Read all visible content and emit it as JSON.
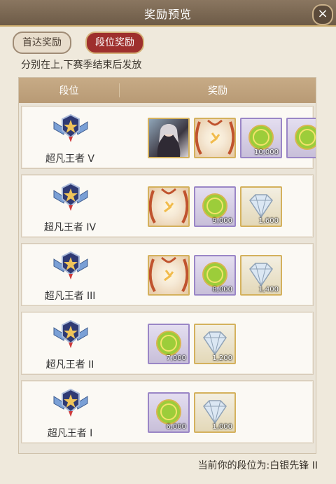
{
  "header": {
    "title": "奖励预览",
    "close_label": "×"
  },
  "tabs": [
    {
      "label": "首达奖励",
      "active": false
    },
    {
      "label": "段位奖励",
      "active": true
    }
  ],
  "subtitle": "分别在上,下赛季结束后发放",
  "table": {
    "headers": {
      "rank": "段位",
      "reward": "奖励"
    },
    "rows": [
      {
        "rank": "超凡王者 V",
        "rewards": [
          {
            "icon": "character-portrait-icon",
            "qty": ""
          },
          {
            "icon": "treasure-chest-icon",
            "qty": ""
          },
          {
            "icon": "gold-coin-icon",
            "qty": "10,000"
          },
          {
            "icon": "gold-coin-icon",
            "qty": ""
          }
        ]
      },
      {
        "rank": "超凡王者 IV",
        "rewards": [
          {
            "icon": "treasure-chest-icon",
            "qty": ""
          },
          {
            "icon": "gold-coin-icon",
            "qty": "9,000"
          },
          {
            "icon": "diamond-icon",
            "qty": "1,600"
          }
        ]
      },
      {
        "rank": "超凡王者 III",
        "rewards": [
          {
            "icon": "treasure-chest-icon",
            "qty": ""
          },
          {
            "icon": "gold-coin-icon",
            "qty": "8,000"
          },
          {
            "icon": "diamond-icon",
            "qty": "1,400"
          }
        ]
      },
      {
        "rank": "超凡王者 II",
        "rewards": [
          {
            "icon": "gold-coin-icon",
            "qty": "7,000"
          },
          {
            "icon": "diamond-icon",
            "qty": "1,200"
          }
        ]
      },
      {
        "rank": "超凡王者 I",
        "rewards": [
          {
            "icon": "gold-coin-icon",
            "qty": "6,000"
          },
          {
            "icon": "diamond-icon",
            "qty": "1,000"
          }
        ]
      }
    ]
  },
  "current_rank": "当前你的段位为:白银先锋 II",
  "colors": {
    "accent_red": "#9e2f2d",
    "header_brown": "#b89a75"
  }
}
